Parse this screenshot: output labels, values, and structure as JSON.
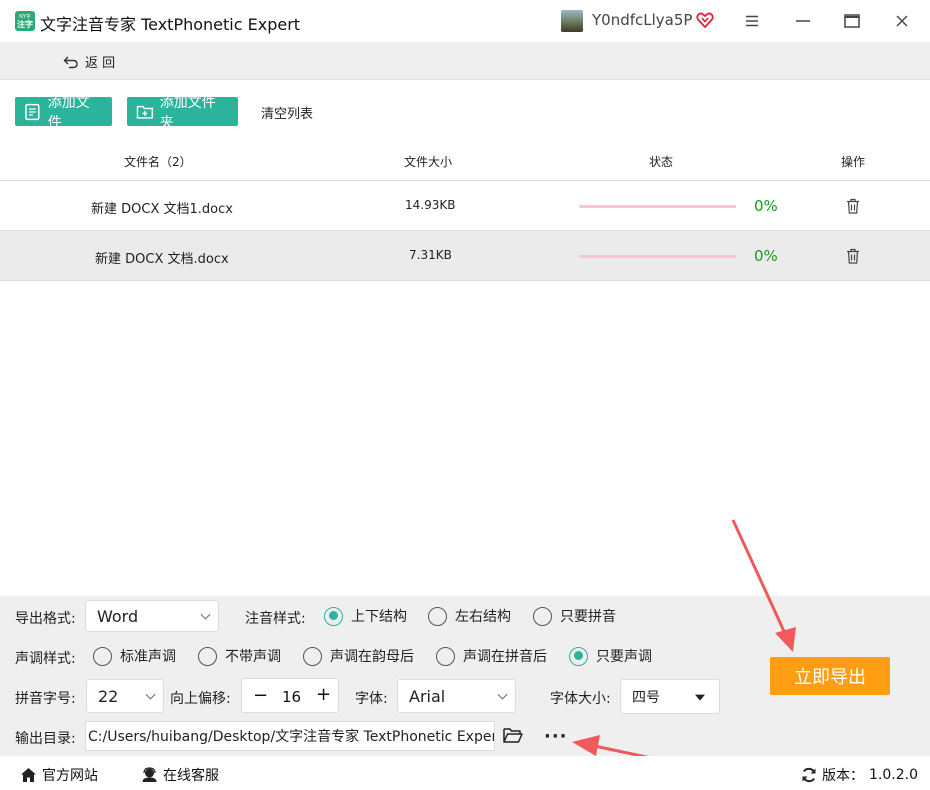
{
  "app": {
    "logo_top": "NY字",
    "logo_bottom": "注字",
    "title": "文字注音专家 TextPhonetic Expert",
    "user_name": "Y0ndfcLlya5P"
  },
  "nav": {
    "back_label": "返 回"
  },
  "toolbar": {
    "add_file": "添加文件",
    "add_folder": "添加文件夹",
    "clear_list": "清空列表"
  },
  "table": {
    "headers": {
      "name": "文件名（2）",
      "size": "文件大小",
      "status": "状态",
      "action": "操作"
    },
    "rows": [
      {
        "name": "新建 DOCX 文档1.docx",
        "size": "14.93KB",
        "progress": 0,
        "percent": "0%"
      },
      {
        "name": "新建 DOCX 文档.docx",
        "size": "7.31KB",
        "progress": 0,
        "percent": "0%"
      }
    ]
  },
  "settings": {
    "export_format_label": "导出格式:",
    "export_format_value": "Word",
    "annotation_style_label": "注音样式:",
    "annotation_options": [
      "上下结构",
      "左右结构",
      "只要拼音"
    ],
    "annotation_selected": 0,
    "tone_style_label": "声调样式:",
    "tone_options": [
      "标准声调",
      "不带声调",
      "声调在韵母后",
      "声调在拼音后",
      "只要声调"
    ],
    "tone_selected": 4,
    "pinyin_size_label": "拼音字号:",
    "pinyin_size_value": "22",
    "offset_label": "向上偏移:",
    "offset_minus": "−",
    "offset_value": "16",
    "offset_plus": "+",
    "font_label": "字体:",
    "font_value": "Arial",
    "font_size_label": "字体大小:",
    "font_size_value": "四号",
    "output_dir_label": "输出目录:",
    "output_dir_value": "C:/Users/huibang/Desktop/文字注音专家 TextPhonetic Expert",
    "more_label": "···",
    "export_button": "立即导出"
  },
  "footer": {
    "website": "官方网站",
    "support": "在线客服",
    "version_label": "版本：",
    "version": "1.0.2.0"
  },
  "colors": {
    "accent": "#2bb39b",
    "export": "#ff9e12",
    "progress_track": "#f2c6d2",
    "percent": "#1a9a1a",
    "annotation_arrow": "#f05a5a"
  }
}
